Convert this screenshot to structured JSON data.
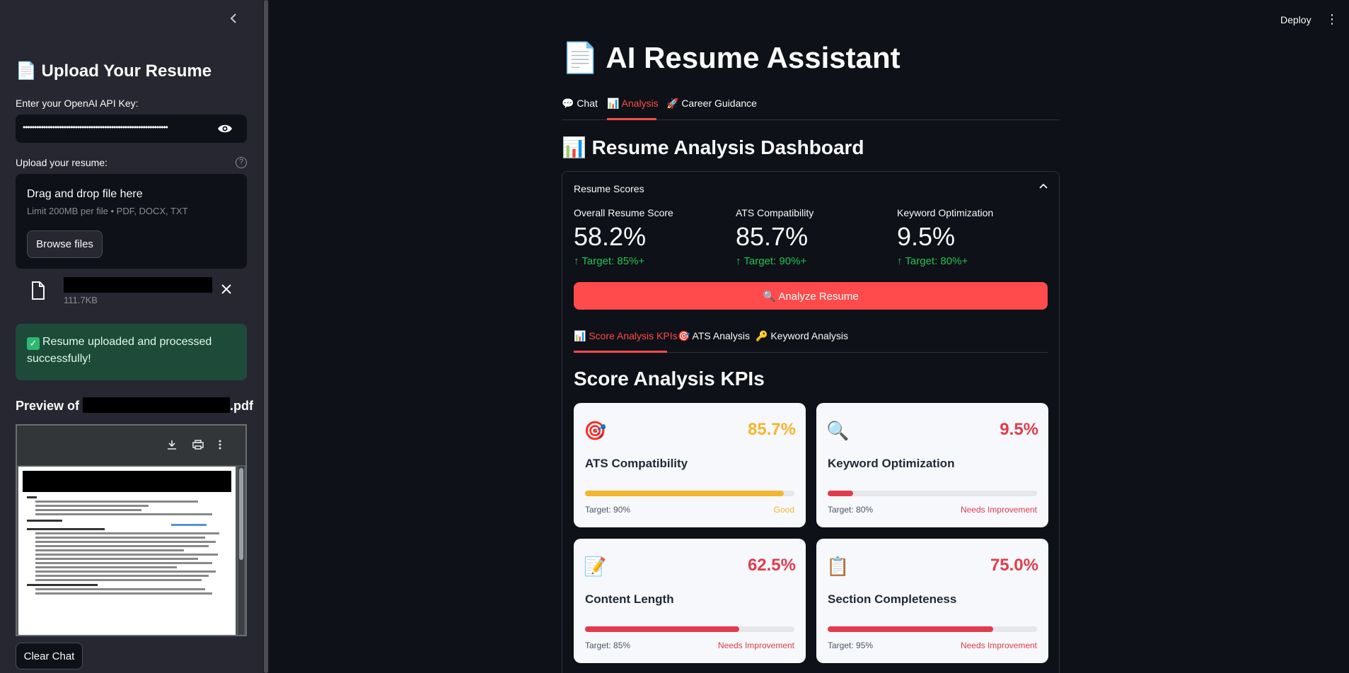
{
  "sidebar": {
    "collapse_icon": "chevron-left-icon",
    "title": "📄 Upload Your Resume",
    "api_label": "Enter your OpenAI API Key:",
    "api_value": "••••••••••••••••••••••••••••••••••••••••••••••••••••••••••••••••",
    "upload_label": "Upload your resume:",
    "dropzone_title": "Drag and drop file here",
    "dropzone_limit": "Limit 200MB per file • PDF, DOCX, TXT",
    "browse_label": "Browse files",
    "file_name": "",
    "file_size": "111.7KB",
    "success_check": "✓",
    "success_text": "Resume uploaded and processed successfully!",
    "preview_prefix": "Preview of ",
    "preview_suffix": ".pdf",
    "clear_label": "Clear Chat"
  },
  "header": {
    "deploy_label": "Deploy",
    "menu_icon": "⋮"
  },
  "main": {
    "title": "📄 AI Resume Assistant",
    "tabs": [
      {
        "label": "💬 Chat"
      },
      {
        "label": "📊 Analysis"
      },
      {
        "label": "🚀 Career Guidance"
      }
    ],
    "section_title": "📊 Resume Analysis Dashboard",
    "expander_title": "Resume Scores",
    "metrics": [
      {
        "label": "Overall Resume Score",
        "value": "58.2%",
        "delta": "↑ Target: 85%+"
      },
      {
        "label": "ATS Compatibility",
        "value": "85.7%",
        "delta": "↑ Target: 90%+"
      },
      {
        "label": "Keyword Optimization",
        "value": "9.5%",
        "delta": "↑ Target: 80%+"
      }
    ],
    "analyze_label": "🔍 Analyze Resume",
    "subtabs": [
      {
        "label": "📊 Score Analysis KPIs"
      },
      {
        "label": "🎯 ATS Analysis"
      },
      {
        "label": "🔑 Keyword Analysis"
      }
    ],
    "kpi_title": "Score Analysis KPIs",
    "cards": [
      {
        "icon": "🎯",
        "percent": "85.7%",
        "progress": 0.95,
        "name": "ATS Compatibility",
        "target": "Target: 90%",
        "status": "Good",
        "color": "#f4b62f"
      },
      {
        "icon": "🔍",
        "percent": "9.5%",
        "progress": 0.12,
        "name": "Keyword Optimization",
        "target": "Target: 80%",
        "status": "Needs Improvement",
        "color": "#e03c4d"
      },
      {
        "icon": "📝",
        "percent": "62.5%",
        "progress": 0.735,
        "name": "Content Length",
        "target": "Target: 85%",
        "status": "Needs Improvement",
        "color": "#e03c4d"
      },
      {
        "icon": "📋",
        "percent": "75.0%",
        "progress": 0.79,
        "name": "Section Completeness",
        "target": "Target: 95%",
        "status": "Needs Improvement",
        "color": "#e03c4d"
      }
    ]
  },
  "colors": {
    "accent": "#ff4b4b",
    "success": "#21c354",
    "background": "#0e1117",
    "sidebar": "#262730"
  }
}
